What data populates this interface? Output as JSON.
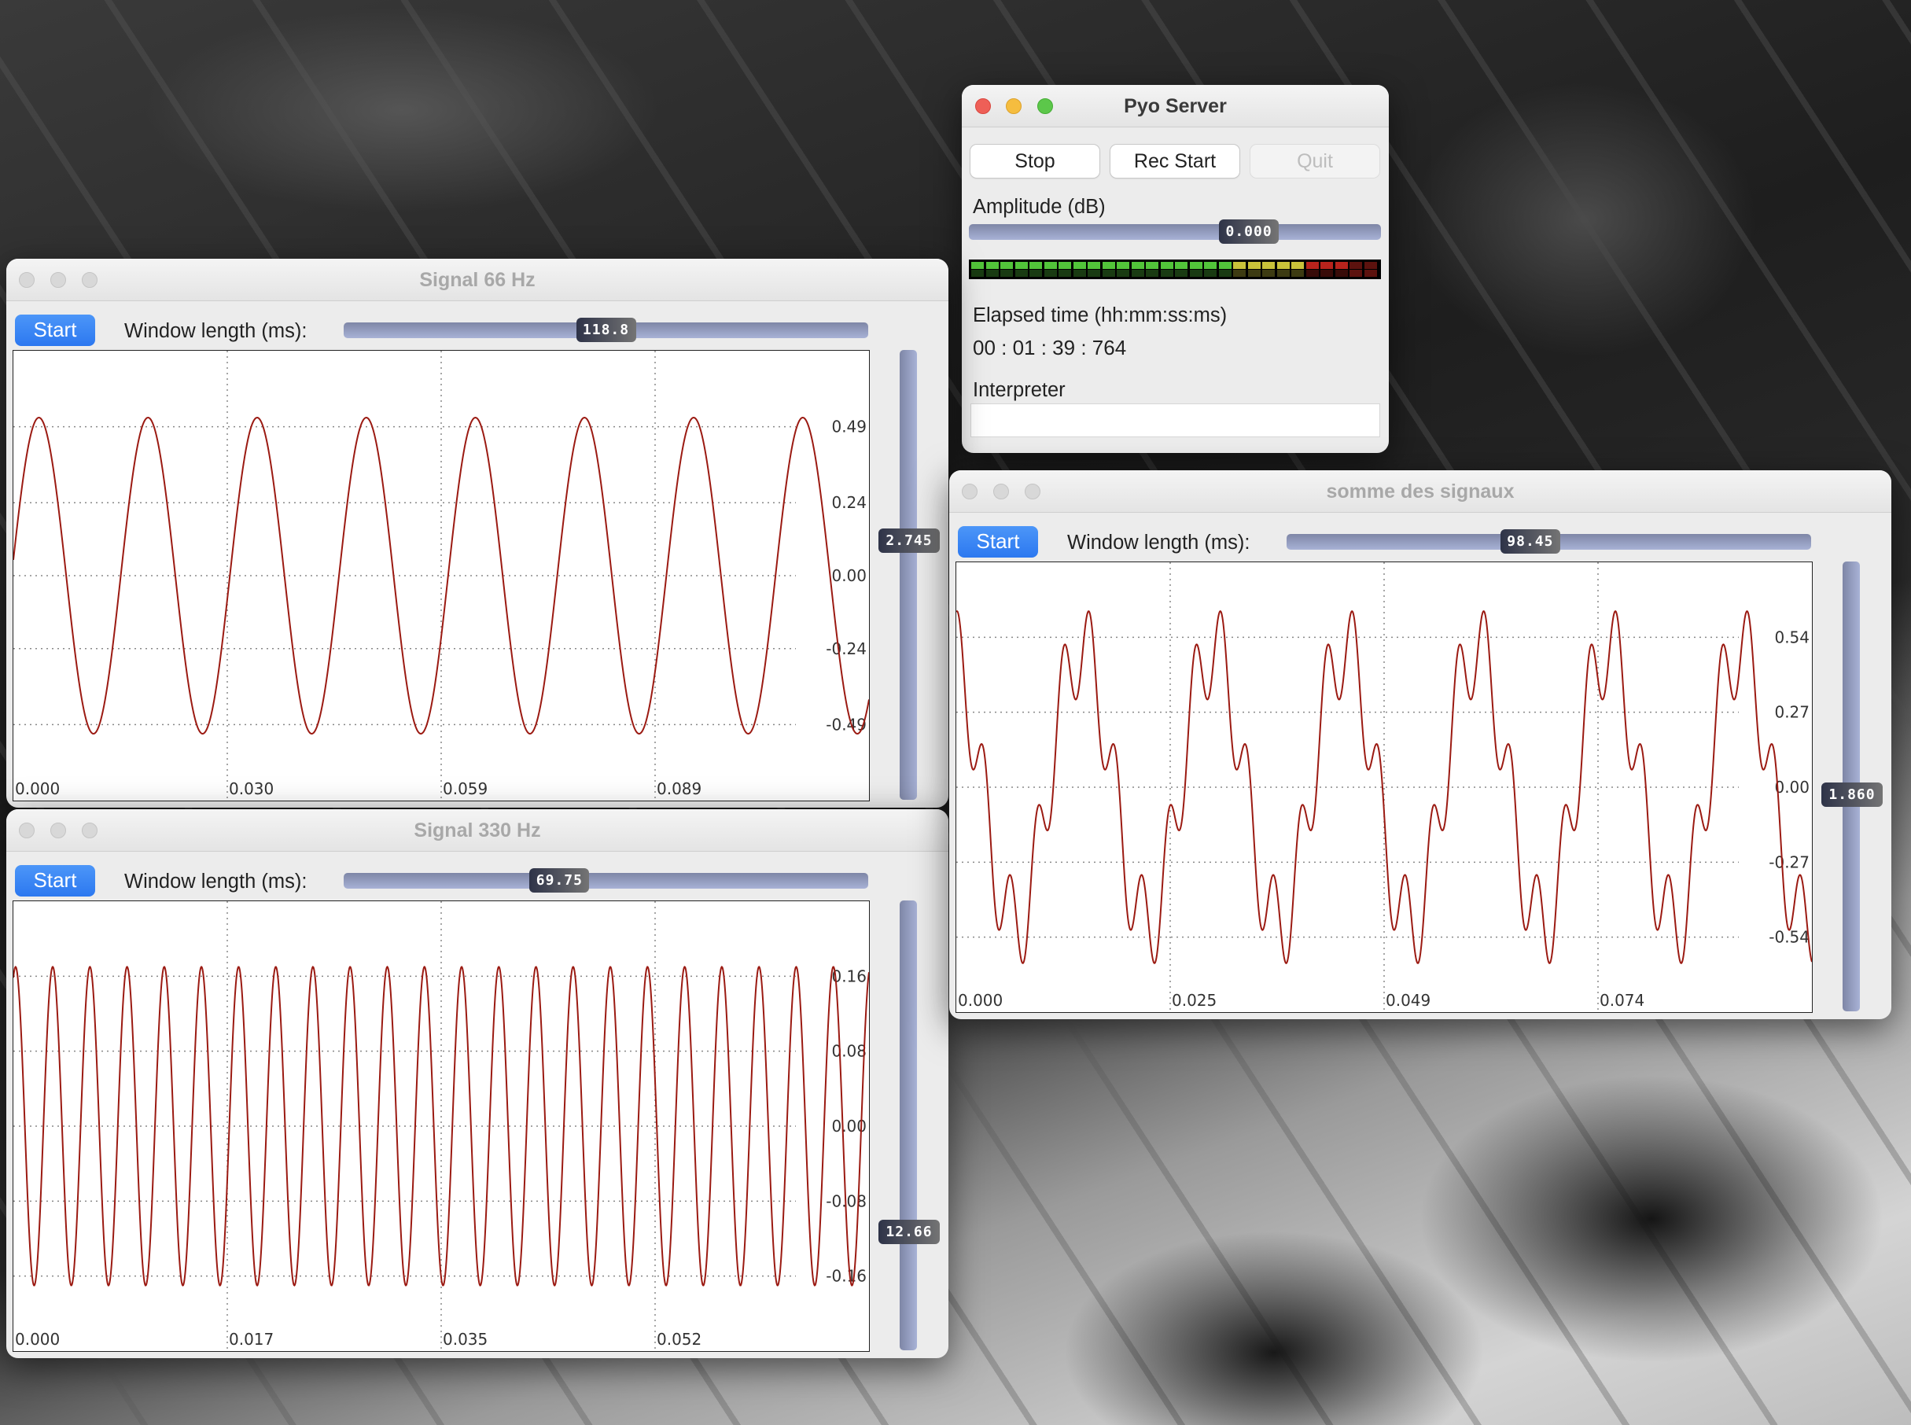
{
  "server": {
    "title": "Pyo Server",
    "stop_label": "Stop",
    "rec_label": "Rec Start",
    "quit_label": "Quit",
    "amplitude_label": "Amplitude (dB)",
    "amplitude_value": "0.000",
    "amplitude_fraction": 0.71,
    "meter": {
      "segments": 28,
      "lit": 26,
      "colors": {
        "green": "#52c43a",
        "yellow": "#c9c23a",
        "red": "#b8231c"
      }
    },
    "elapsed_label": "Elapsed time (hh:mm:ss:ms)",
    "elapsed_value": "00 : 01 : 39 : 764",
    "interpreter_label": "Interpreter",
    "interpreter_value": ""
  },
  "scopes": [
    {
      "title": "Signal 66 Hz",
      "start_label": "Start",
      "window_label": "Window length (ms):",
      "window_value": "118.8",
      "window_fraction": 0.5,
      "gain_value": "2.745",
      "gain_fraction": 0.58
    },
    {
      "title": "Signal 330 Hz",
      "start_label": "Start",
      "window_label": "Window length (ms):",
      "window_value": "69.75",
      "window_fraction": 0.4,
      "gain_value": "12.66",
      "gain_fraction": 0.25
    },
    {
      "title": "somme des signaux",
      "start_label": "Start",
      "window_label": "Window length (ms):",
      "window_value": "98.45",
      "window_fraction": 0.46,
      "gain_value": "1.860",
      "gain_fraction": 0.48
    }
  ],
  "chart_data": [
    {
      "type": "line",
      "xlim": [
        0,
        0.1188
      ],
      "ylim": [
        -0.74,
        0.74
      ],
      "x_ticks": [
        "0.000",
        "0.030",
        "0.059",
        "0.089"
      ],
      "y_ticks": [
        "0.49",
        "0.24",
        "0.00",
        "-0.24",
        "-0.49"
      ],
      "y_tick_values": [
        0.49,
        0.24,
        0.0,
        -0.24,
        -0.49
      ],
      "grid": true,
      "color": "#9b1a12",
      "series": [
        {
          "components": [
            {
              "freq_hz": 66,
              "amplitude": 0.52,
              "phase": 0.1
            }
          ]
        }
      ]
    },
    {
      "type": "line",
      "xlim": [
        0,
        0.06975
      ],
      "ylim": [
        -0.24,
        0.24
      ],
      "x_ticks": [
        "0.000",
        "0.017",
        "0.035",
        "0.052"
      ],
      "y_ticks": [
        "0.16",
        "0.08",
        "0.00",
        "-0.08",
        "-0.16"
      ],
      "y_tick_values": [
        0.16,
        0.08,
        0.0,
        -0.08,
        -0.16
      ],
      "grid": true,
      "color": "#9b1a12",
      "series": [
        {
          "components": [
            {
              "freq_hz": 330,
              "amplitude": 0.17,
              "phase": 1.2
            }
          ]
        }
      ]
    },
    {
      "type": "line",
      "xlim": [
        0,
        0.09845
      ],
      "ylim": [
        -0.81,
        0.81
      ],
      "x_ticks": [
        "0.000",
        "0.025",
        "0.049",
        "0.074"
      ],
      "y_ticks": [
        "0.54",
        "0.27",
        "0.00",
        "-0.27",
        "-0.54"
      ],
      "y_tick_values": [
        0.54,
        0.27,
        0.0,
        -0.27,
        -0.54
      ],
      "grid": true,
      "color": "#9b1a12",
      "series": [
        {
          "components": [
            {
              "freq_hz": 66,
              "amplitude": 0.5,
              "phase": 1.9
            },
            {
              "freq_hz": 330,
              "amplitude": 0.17,
              "phase": 1.2
            }
          ]
        }
      ]
    }
  ]
}
